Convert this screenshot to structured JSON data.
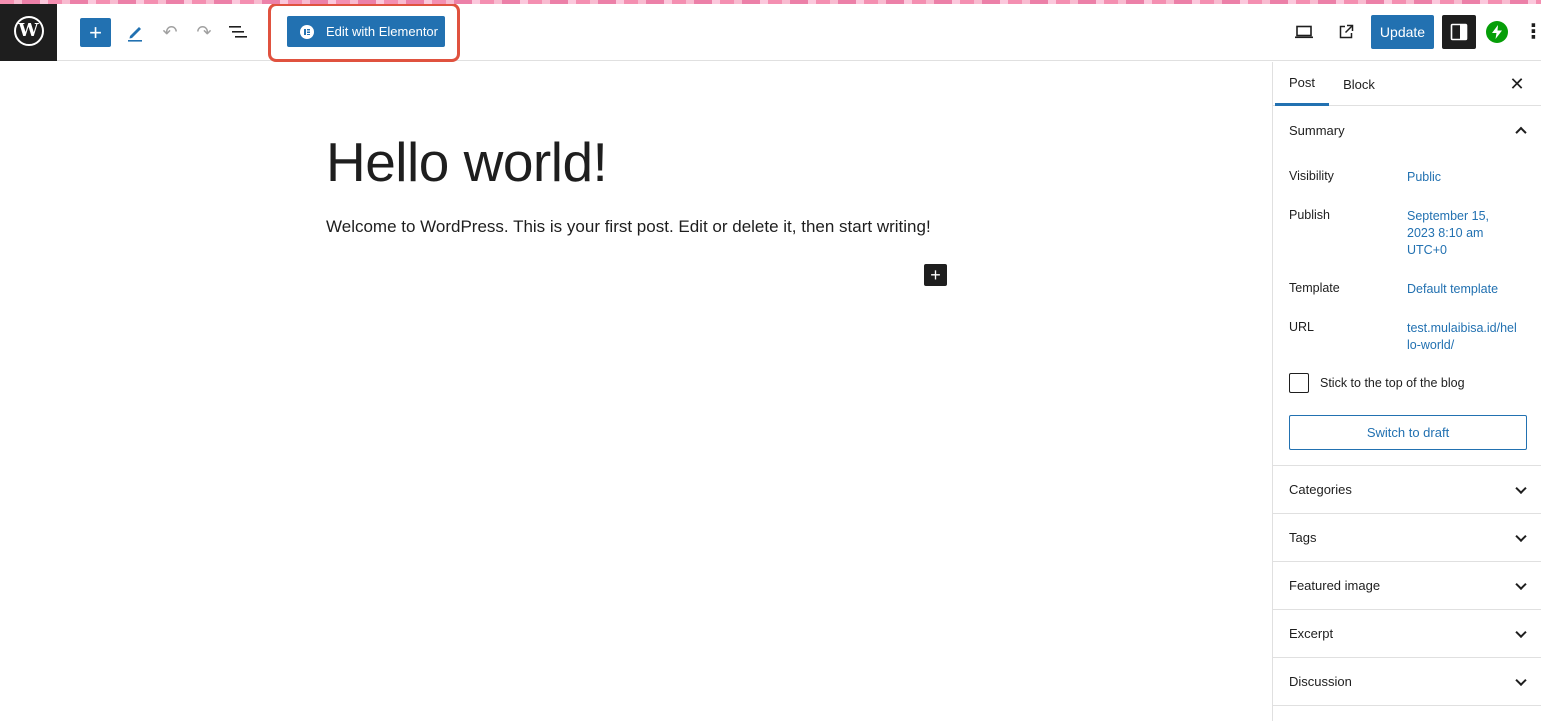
{
  "toolbar": {
    "logo": "W",
    "inserter_label": "+",
    "undo_label": "↶",
    "redo_label": "↷",
    "elementor_label": "Edit with Elementor",
    "update_label": "Update",
    "more_label": "⋮",
    "accent_color": "#2271b1",
    "highlight_color": "#e0523f"
  },
  "editor": {
    "title": "Hello world!",
    "paragraph": "Welcome to WordPress. This is your first post. Edit or delete it, then start writing!",
    "block_add_label": "+"
  },
  "sidebar": {
    "tabs": {
      "post": "Post",
      "block": "Block"
    },
    "close_label": "✕",
    "summary": {
      "heading": "Summary",
      "visibility_label": "Visibility",
      "visibility_value": "Public",
      "publish_label": "Publish",
      "publish_value": "September 15, 2023 8:10 am UTC+0",
      "template_label": "Template",
      "template_value": "Default template",
      "url_label": "URL",
      "url_value": "test.mulaibisa.id/hello-world/",
      "sticky_label": "Stick to the top of the blog",
      "switch_draft_label": "Switch to draft"
    },
    "panels": [
      "Categories",
      "Tags",
      "Featured image",
      "Excerpt",
      "Discussion"
    ]
  }
}
